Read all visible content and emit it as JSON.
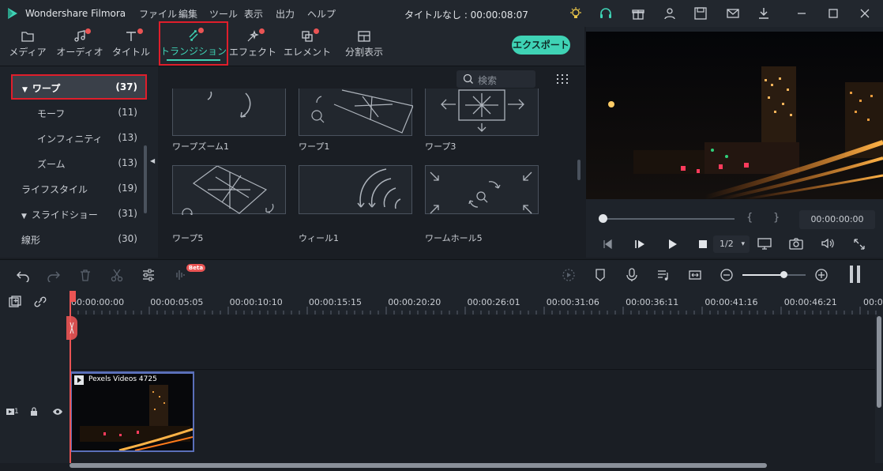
{
  "titlebar": {
    "app_name": "Wondershare Filmora",
    "menu": [
      "ファイル",
      "編集",
      "ツール",
      "表示",
      "出力",
      "ヘルプ"
    ],
    "window_title": "タイトルなし : 00:00:08:07"
  },
  "tabs": [
    {
      "label": "メディア",
      "icon": "folder-icon",
      "dot": false
    },
    {
      "label": "オーディオ",
      "icon": "music-note-icon",
      "dot": true
    },
    {
      "label": "タイトル",
      "icon": "text-t-icon",
      "dot": true
    },
    {
      "label": "トランジション",
      "icon": "transition-icon",
      "dot": true,
      "active": true
    },
    {
      "label": "エフェクト",
      "icon": "effects-icon",
      "dot": true
    },
    {
      "label": "エレメント",
      "icon": "elements-icon",
      "dot": true
    },
    {
      "label": "分割表示",
      "icon": "split-screen-icon",
      "dot": false
    }
  ],
  "export_label": "エクスポート",
  "search_placeholder": "検索",
  "categories": [
    {
      "label": "ワープ",
      "count": "(37)",
      "expanded": true,
      "selected": true
    },
    {
      "label": "モーフ",
      "count": "(11)",
      "sub": true
    },
    {
      "label": "インフィニティ",
      "count": "(13)",
      "sub": true
    },
    {
      "label": "ズーム",
      "count": "(13)",
      "sub": true
    },
    {
      "label": "ライフスタイル",
      "count": "(19)"
    },
    {
      "label": "スライドショー",
      "count": "(31)",
      "expanded": true
    },
    {
      "label": "線形",
      "count": "(30)"
    }
  ],
  "transitions": [
    {
      "label": "ワープズーム1"
    },
    {
      "label": "ワープ1"
    },
    {
      "label": "ワープ3"
    },
    {
      "label": "ワープ5"
    },
    {
      "label": "ウィール1"
    },
    {
      "label": "ワームホール5"
    }
  ],
  "preview": {
    "mark_in": "{",
    "mark_out": "}",
    "timecode": "00:00:00:00",
    "quality": "1/2"
  },
  "ruler_ticks": [
    "00:00:00:00",
    "00:00:05:05",
    "00:00:10:10",
    "00:00:15:15",
    "00:00:20:20",
    "00:00:26:01",
    "00:00:31:06",
    "00:00:36:11",
    "00:00:41:16",
    "00:00:46:21",
    "00:0"
  ],
  "timeline": {
    "beta_badge": "Beta",
    "track_number": "1",
    "clip_name": "Pexels Videos 4725",
    "zoom_fraction": 0.65
  },
  "colors": {
    "accent": "#3fd3b5",
    "notification_dot": "#ea5454",
    "highlight_box": "#e01e2b",
    "playhead": "#ea5454"
  }
}
